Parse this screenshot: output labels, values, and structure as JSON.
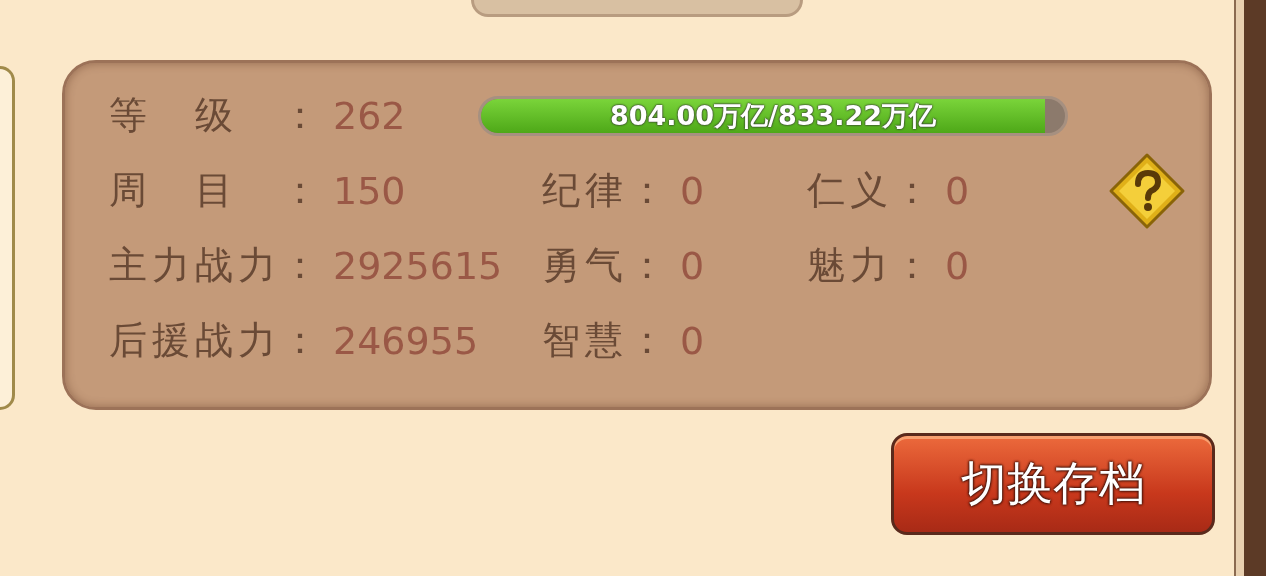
{
  "level": {
    "label": "等级：",
    "value": "262"
  },
  "exp_bar": {
    "text": "804.00万亿/833.22万亿",
    "level": 0.965
  },
  "stats": [
    [
      {
        "label": "周目：",
        "value": "150"
      },
      {
        "label": "纪律：",
        "value": "0"
      },
      {
        "label": "仁义：",
        "value": "0"
      }
    ],
    [
      {
        "label": "主力战力：",
        "value": "2925615"
      },
      {
        "label": "勇气：",
        "value": "0"
      },
      {
        "label": "魅力：",
        "value": "0"
      }
    ],
    [
      {
        "label": "后援战力：",
        "value": "246955"
      },
      {
        "label": "智慧：",
        "value": "0"
      }
    ]
  ],
  "switch_button": {
    "label": "切换存档"
  }
}
